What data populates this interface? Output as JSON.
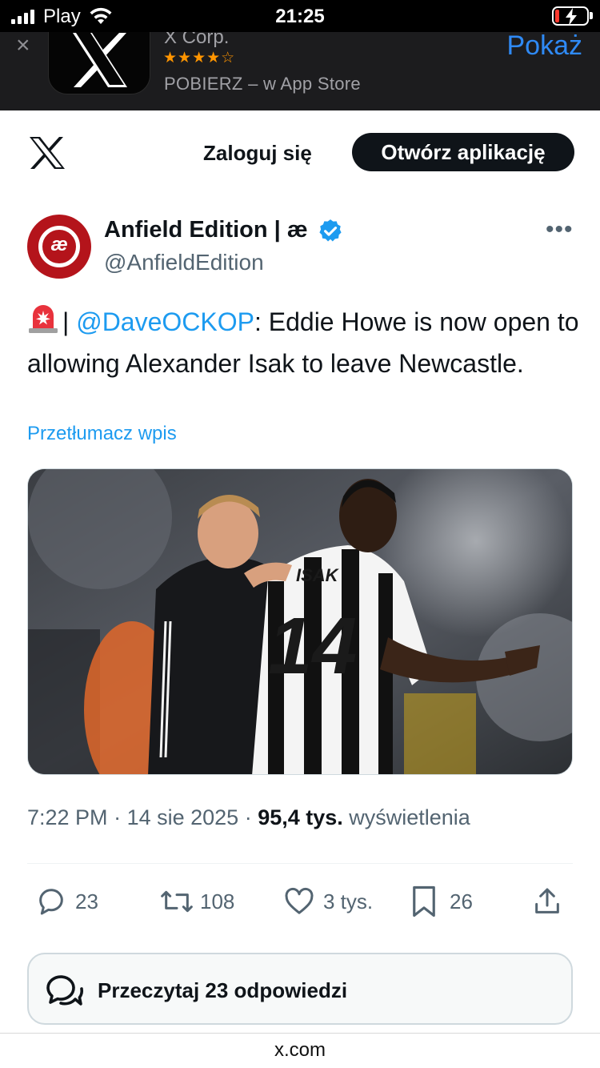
{
  "status_bar": {
    "carrier": "Play",
    "time": "21:25",
    "icons": [
      "signal-icon",
      "wifi-icon",
      "battery-charging-icon"
    ]
  },
  "app_banner": {
    "app_name": "X Corp.",
    "rating_stars": "★★★★☆",
    "rating": 4.5,
    "subtitle": "POBIERZ – w App Store",
    "action": "Pokaż",
    "close_icon": "close-icon"
  },
  "top_nav": {
    "logo": "x-logo-icon",
    "login": "Zaloguj się",
    "open_app": "Otwórz aplikację"
  },
  "author": {
    "name": "Anfield Edition | æ",
    "handle": "@AnfieldEdition",
    "avatar_text": "æ",
    "verified": true,
    "more": "•••"
  },
  "tweet": {
    "prefix": "| ",
    "mention": "@DaveOCKOP",
    "text": ": Eddie Howe is now open to allowing Alexander Isak to leave Newcastle.",
    "translate": "Przetłumacz wpis",
    "image_label_name": "ISAK",
    "image_label_number": "14"
  },
  "meta": {
    "time": "7:22 PM",
    "sep1": " · ",
    "date": "14 sie 2025",
    "sep2": " · ",
    "views": "95,4 tys.",
    "views_label": " wyświetlenia"
  },
  "actions": {
    "replies": "23",
    "retweets": "108",
    "likes": "3 tys.",
    "bookmarks": "26"
  },
  "read_replies": "Przeczytaj 23 odpowiedzi",
  "footer_url": "x.com",
  "colors": {
    "accent": "#1d9bf0",
    "text": "#0f1419",
    "muted": "#536471",
    "avatar_red": "#b4141b",
    "star_orange": "#ff9500"
  }
}
